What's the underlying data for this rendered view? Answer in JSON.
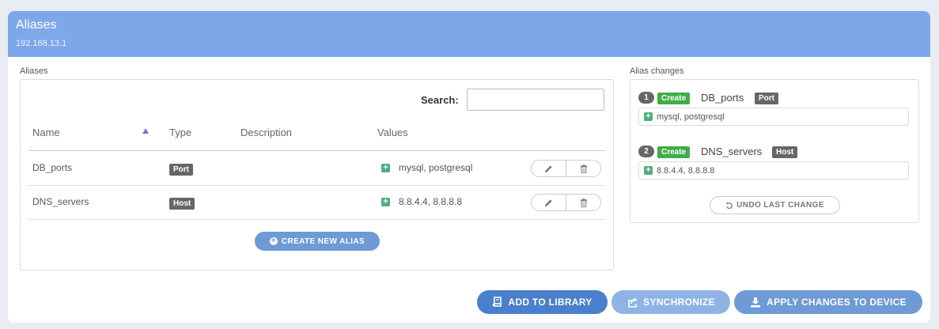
{
  "header": {
    "title": "Aliases",
    "subtitle": "192.168.13.1"
  },
  "aliases_section": {
    "label": "Aliases",
    "search_label": "Search:",
    "search_value": "",
    "columns": [
      "Name",
      "Type",
      "Description",
      "Values"
    ],
    "rows": [
      {
        "name": "DB_ports",
        "type": "Port",
        "description": "",
        "values": "mysql, postgresql"
      },
      {
        "name": "DNS_servers",
        "type": "Host",
        "description": "",
        "values": "8.8.4.4, 8.8.8.8"
      }
    ],
    "create_button": "CREATE NEW ALIAS"
  },
  "changes_section": {
    "label": "Alias changes",
    "items": [
      {
        "index": "1",
        "action": "Create",
        "name": "DB_ports",
        "type": "Port",
        "values": "mysql, postgresql"
      },
      {
        "index": "2",
        "action": "Create",
        "name": "DNS_servers",
        "type": "Host",
        "values": "8.8.4.4, 8.8.8.8"
      }
    ],
    "undo_button": "UNDO LAST CHANGE"
  },
  "footer": {
    "add_library": "ADD TO LIBRARY",
    "synchronize": "SYNCHRONIZE",
    "apply": "APPLY CHANGES TO DEVICE"
  },
  "colors": {
    "header": "#7ca8ea",
    "primary_button": "#4a7fcb",
    "disabled_button": "#8fb3e4",
    "create_badge": "#3fae49",
    "value_icon": "#4caf7d"
  }
}
